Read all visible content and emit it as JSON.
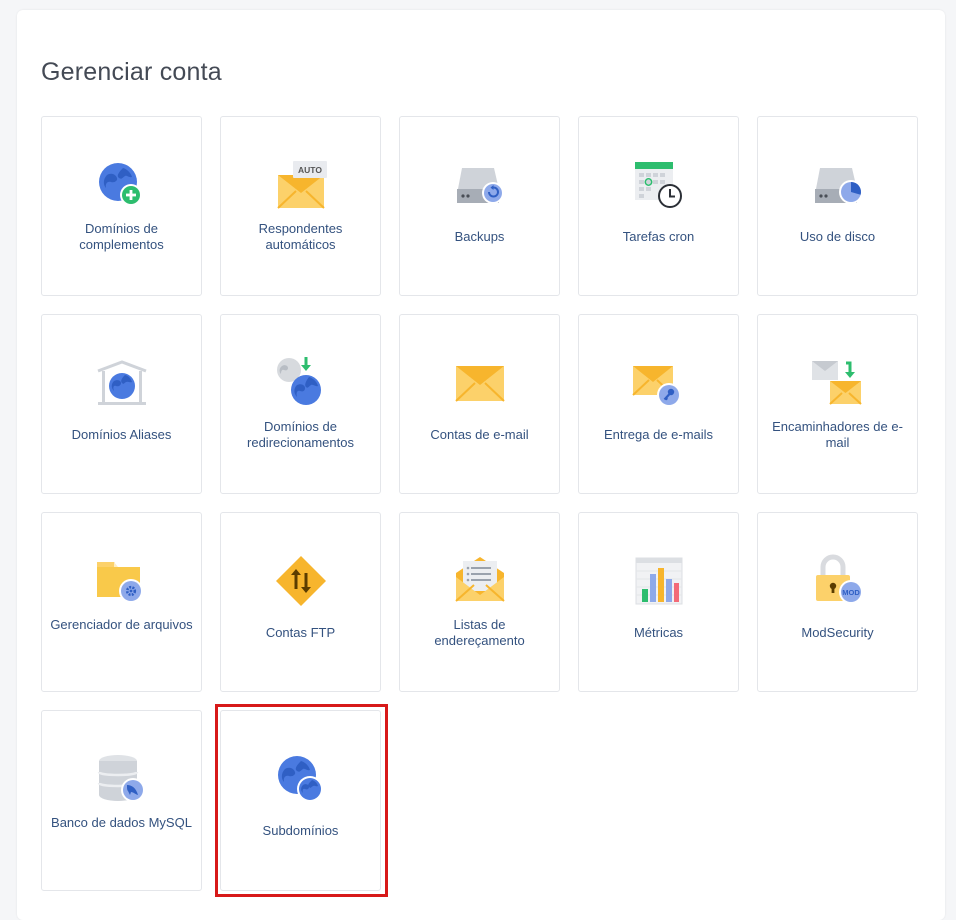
{
  "page": {
    "title": "Gerenciar conta"
  },
  "tiles": [
    {
      "label": "Domínios de complementos",
      "icon": "globe-plus-icon"
    },
    {
      "label": "Respondentes automáticos",
      "icon": "envelope-auto-icon",
      "badge": "AUTO"
    },
    {
      "label": "Backups",
      "icon": "drive-restore-icon"
    },
    {
      "label": "Tarefas cron",
      "icon": "calendar-clock-icon"
    },
    {
      "label": "Uso de disco",
      "icon": "drive-pie-icon"
    },
    {
      "label": "Domínios Aliases",
      "icon": "globe-shelter-icon"
    },
    {
      "label": "Domínios de redirecionamentos",
      "icon": "globe-redirect-icon"
    },
    {
      "label": "Contas de e-mail",
      "icon": "envelope-icon"
    },
    {
      "label": "Entrega de e-mails",
      "icon": "envelope-key-icon"
    },
    {
      "label": "Encaminhadores de e-mail",
      "icon": "envelope-forward-icon"
    },
    {
      "label": "Gerenciador de arquivos",
      "icon": "folder-gear-icon"
    },
    {
      "label": "Contas FTP",
      "icon": "ftp-arrows-icon"
    },
    {
      "label": "Listas de endereçamento",
      "icon": "envelope-list-icon"
    },
    {
      "label": "Métricas",
      "icon": "bar-chart-icon"
    },
    {
      "label": "ModSecurity",
      "icon": "padlock-mod-icon",
      "badge": "MOD"
    },
    {
      "label": "Banco de dados MySQL",
      "icon": "database-dolphin-icon"
    },
    {
      "label": "Subdomínios",
      "icon": "globe-sub-icon"
    }
  ],
  "selection": {
    "highlighted_tile": "Subdomínios",
    "highlight_color": "#d71919"
  },
  "colors": {
    "link": "#34527f",
    "globe": "#4a7ae0",
    "mail": "#fcd16a",
    "accent_green": "#2dbd6e"
  }
}
